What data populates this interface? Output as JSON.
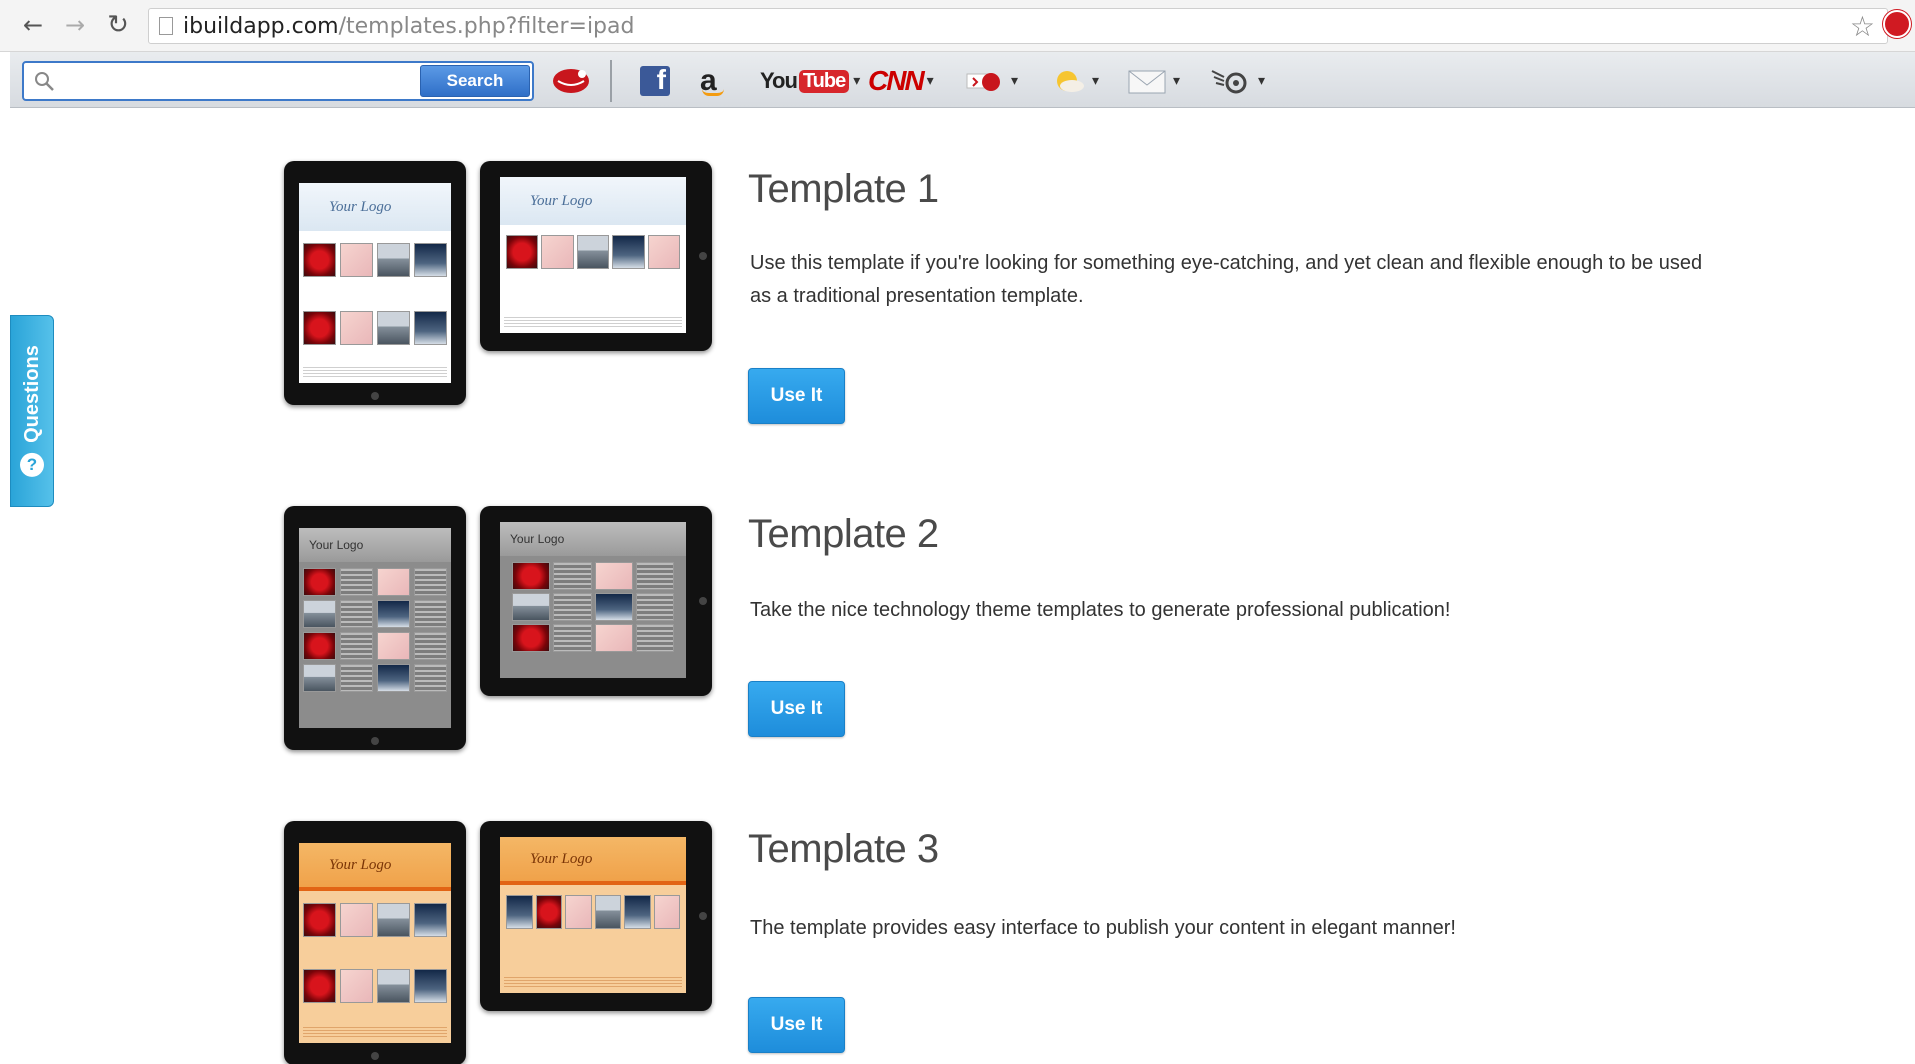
{
  "browser": {
    "url_host": "ibuildapp.com",
    "url_path": "/templates.php?filter=ipad",
    "back_glyph": "←",
    "forward_glyph": "→",
    "reload_glyph": "↻",
    "star_glyph": "☆"
  },
  "toolbar": {
    "search_placeholder": "",
    "search_button": "Search",
    "icons": [
      "lips-icon",
      "facebook-icon",
      "amazon-icon",
      "youtube-icon",
      "cnn-icon",
      "weather-icon",
      "sun-icon",
      "mail-icon",
      "settings-icon"
    ],
    "facebook_glyph": "f",
    "amazon_glyph": "a",
    "youtube_you": "You",
    "youtube_tube": "Tube",
    "cnn_label": "CNN",
    "dropdown_glyph": "▾"
  },
  "feedback_tab": {
    "label": "Questions",
    "icon_glyph": "?"
  },
  "templates": [
    {
      "title": "Template 1",
      "description": "Use this template if you're looking for something eye-catching, and yet clean and flexible enough to be used as a traditional presentation template.",
      "button": "Use It",
      "theme": "light",
      "logo_text": "Your Logo"
    },
    {
      "title": "Template 2",
      "description": "Take the nice technology theme templates to generate professional publication!",
      "button": "Use It",
      "theme": "dark",
      "logo_text": "Your Logo"
    },
    {
      "title": "Template 3",
      "description": "The template provides easy interface to publish your content in elegant manner!",
      "button": "Use It",
      "theme": "orange",
      "logo_text": "Your Logo"
    }
  ],
  "colors": {
    "accent_button": "#1e8ddb",
    "feedback_tab": "#2aa4d8",
    "search_border": "#3d79c9"
  }
}
